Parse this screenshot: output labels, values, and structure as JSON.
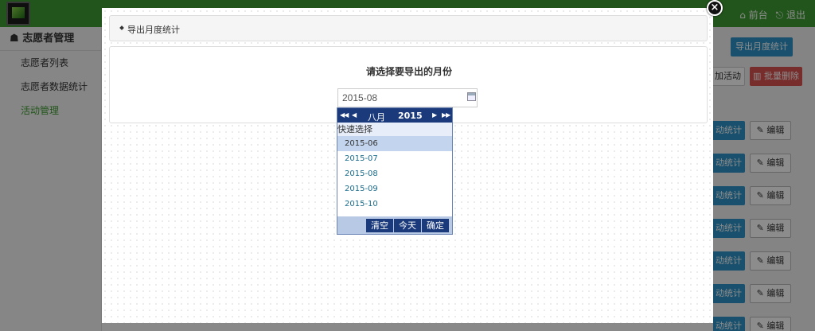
{
  "top_nav": {
    "frontend_label": "前台",
    "logout_label": "退出"
  },
  "sidebar": {
    "header": "志愿者管理",
    "items": [
      {
        "label": "志愿者列表"
      },
      {
        "label": "志愿者数据统计"
      },
      {
        "label": "活动管理"
      }
    ]
  },
  "background_actions": {
    "export_label": "导出月度统计",
    "activity_label": "加活动",
    "batch_delete_label": "批量删除",
    "row_stat_label": "动统计",
    "row_edit_label": "编辑"
  },
  "modal": {
    "breadcrumb": "导出月度统计",
    "title": "请选择要导出的月份",
    "month_value": "2015-08"
  },
  "picker": {
    "month": "八月",
    "year": "2015",
    "quick_label": "快速选择",
    "options": [
      "2015-06",
      "2015-07",
      "2015-08",
      "2015-09",
      "2015-10"
    ],
    "selected": "2015-06",
    "clear_label": "清空",
    "today_label": "今天",
    "ok_label": "确定"
  },
  "colors": {
    "topbar": "#3f9b32",
    "picker_header": "#1a3a7b",
    "button_primary": "#2e93c7",
    "button_danger": "#d9534f"
  }
}
